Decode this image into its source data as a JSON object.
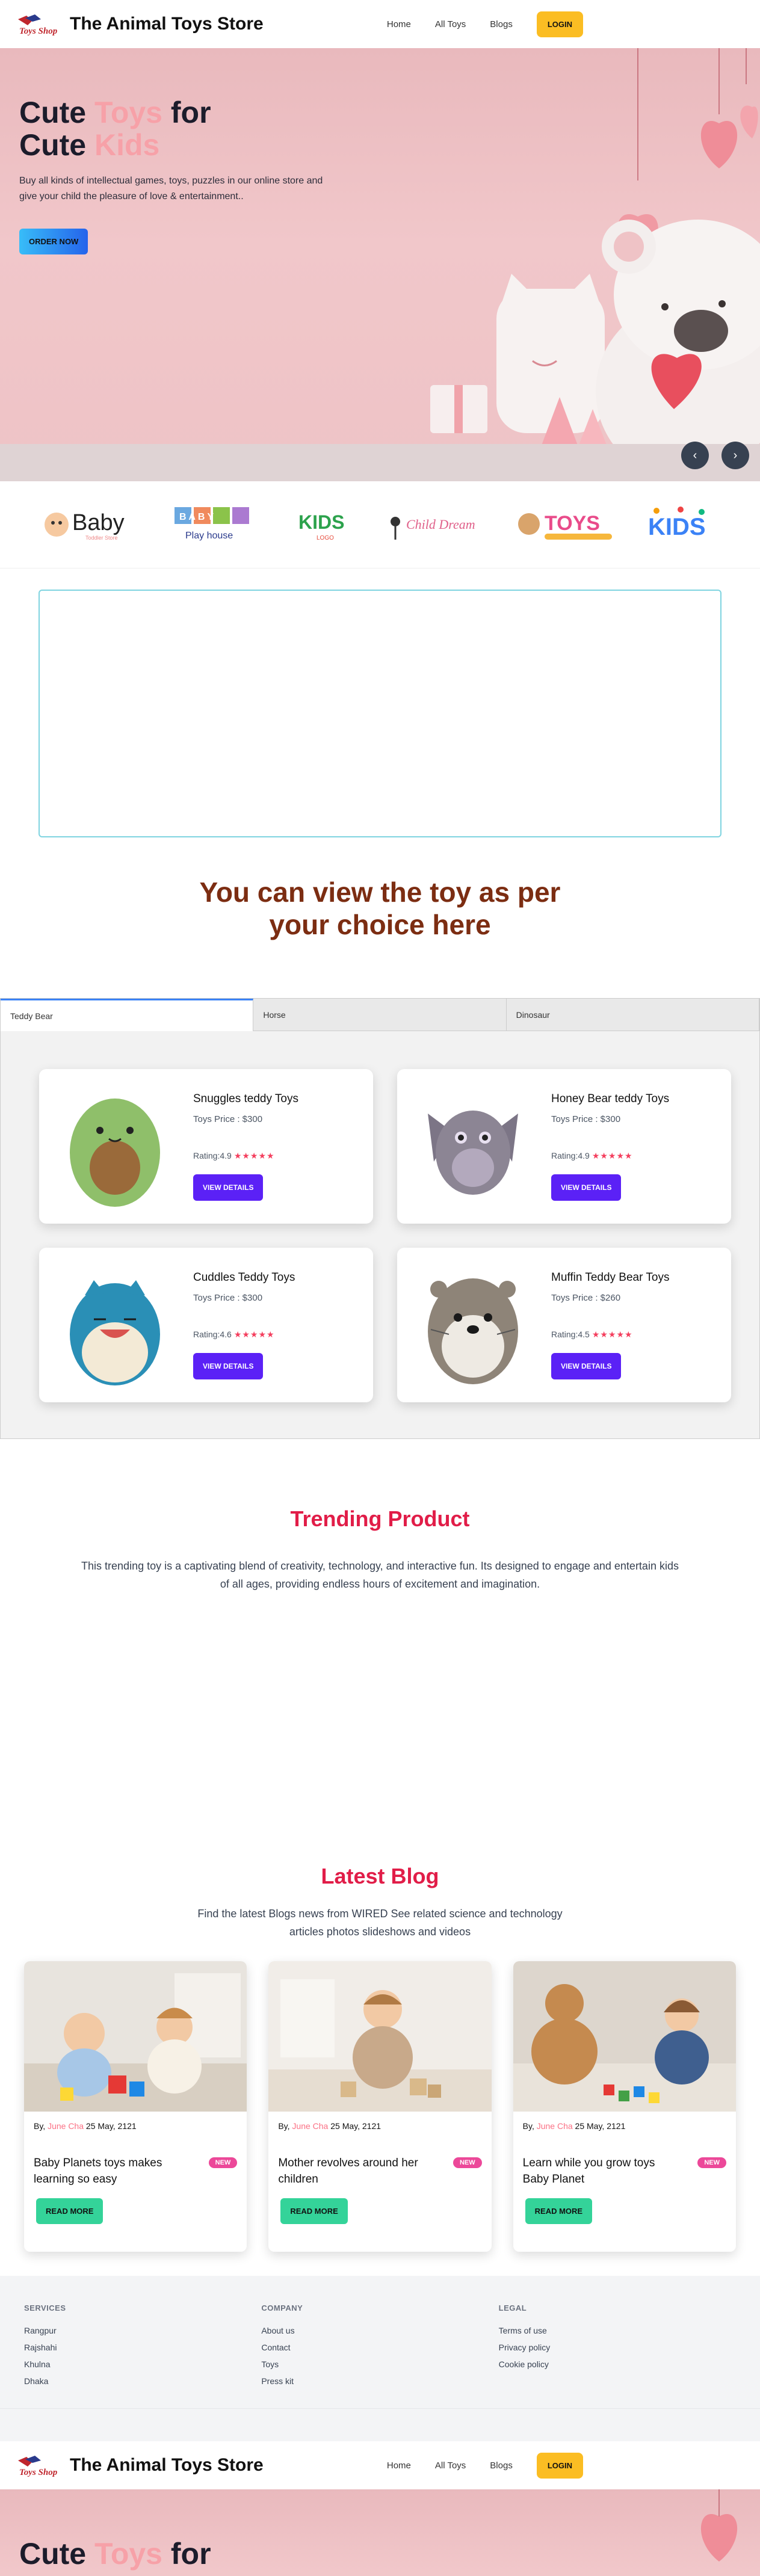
{
  "nav": {
    "brand": "The Animal Toys Store",
    "logo_text": "Toys Shop",
    "links": [
      "Home",
      "All Toys",
      "Blogs"
    ],
    "login": "LOGIN"
  },
  "hero": {
    "title_line1_a": "Cute ",
    "title_line1_b": "Toys",
    "title_line1_c": " for",
    "title_line2_a": "Cute ",
    "title_line2_b": "Kids",
    "text": "Buy all kinds of intellectual games, toys, puzzles in our online store and give your child the pleasure of love & entertainment..",
    "cta": "ORDER NOW",
    "prev": "‹",
    "next": "›"
  },
  "brands": [
    "Baby",
    "Play house",
    "KIDS",
    "Child Dream",
    "TOYS",
    "KIDS"
  ],
  "brand_subs": [
    "Toddler Store",
    "B A B Y",
    "LOGO",
    "",
    "",
    ""
  ],
  "gallery": {
    "title": "You can view the toy as per your choice here"
  },
  "tabs": [
    "Teddy Bear",
    "Horse",
    "Dinosaur"
  ],
  "products": [
    {
      "name": "Snuggles teddy Toys",
      "price": "Toys Price : $300",
      "rating": "Rating:4.9",
      "stars": "★★★★★",
      "button": "VIEW DETAILS",
      "color": "#8fbf6a"
    },
    {
      "name": "Honey Bear teddy Toys",
      "price": "Toys Price : $300",
      "rating": "Rating:4.9",
      "stars": "★★★★★",
      "button": "VIEW DETAILS",
      "color": "#8c8594"
    },
    {
      "name": "Cuddles Teddy Toys",
      "price": "Toys Price : $300",
      "rating": "Rating:4.6",
      "stars": "★★★★★",
      "button": "VIEW DETAILS",
      "color": "#2a8fb6"
    },
    {
      "name": "Muffin Teddy Bear Toys",
      "price": "Toys Price : $260",
      "rating": "Rating:4.5",
      "stars": "★★★★★",
      "button": "VIEW DETAILS",
      "color": "#8e8478"
    }
  ],
  "trending": {
    "title": "Trending Product",
    "text": "This trending toy is a captivating blend of creativity, technology, and interactive fun. Its designed to engage and entertain kids of all ages, providing endless hours of excitement and imagination."
  },
  "blog": {
    "title": "Latest Blog",
    "subtitle": "Find the latest Blogs news from WIRED See related science and technology articles photos slideshows and videos",
    "posts": [
      {
        "by": "By, ",
        "author": "June Cha",
        "date": " 25 May, 2121",
        "title": "Baby Planets toys makes learning so easy",
        "badge": "NEW",
        "button": "READ MORE"
      },
      {
        "by": "By, ",
        "author": "June Cha",
        "date": " 25 May, 2121",
        "title": "Mother revolves around her children",
        "badge": "NEW",
        "button": "READ MORE"
      },
      {
        "by": "By, ",
        "author": "June Cha",
        "date": " 25 May, 2121",
        "title": "Learn while you grow toys Baby Planet",
        "badge": "NEW",
        "button": "READ MORE"
      }
    ]
  },
  "footer": {
    "services_title": "SERVICES",
    "services": [
      "Rangpur",
      "Rajshahi",
      "Khulna",
      "Dhaka"
    ],
    "company_title": "COMPANY",
    "company": [
      "About us",
      "Contact",
      "Toys",
      "Press kit"
    ],
    "legal_title": "LEGAL",
    "legal": [
      "Terms of use",
      "Privacy policy",
      "Cookie policy"
    ]
  },
  "colors": {
    "accent_pink": "#f7a1a8",
    "heading_brown": "#7c2d12",
    "rose": "#e11d48",
    "purple_button": "#5b21f6",
    "login_yellow": "#fbbd23"
  }
}
